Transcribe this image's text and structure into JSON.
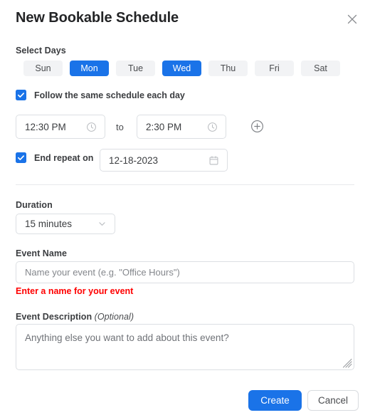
{
  "dialog": {
    "title": "New Bookable Schedule",
    "close_icon": "close-icon"
  },
  "select_days": {
    "label": "Select Days",
    "days": [
      {
        "label": "Sun",
        "selected": false
      },
      {
        "label": "Mon",
        "selected": true
      },
      {
        "label": "Tue",
        "selected": false
      },
      {
        "label": "Wed",
        "selected": true
      },
      {
        "label": "Thu",
        "selected": false
      },
      {
        "label": "Fri",
        "selected": false
      },
      {
        "label": "Sat",
        "selected": false
      }
    ]
  },
  "follow_schedule": {
    "label": "Follow the same schedule each day",
    "checked": true
  },
  "time_range": {
    "start_value": "12:30 PM",
    "separator": "to",
    "end_value": "2:30 PM",
    "start_icon": "clock-icon",
    "end_icon": "clock-icon",
    "add_icon": "plus-circle-icon"
  },
  "end_repeat": {
    "label": "End repeat on",
    "checked": true,
    "date_value": "12-18-2023",
    "date_icon": "calendar-icon"
  },
  "duration": {
    "label": "Duration",
    "value": "15 minutes",
    "chevron_icon": "chevron-down-icon"
  },
  "event_name": {
    "label": "Event Name",
    "value": "",
    "placeholder": "Name your event (e.g. \"Office Hours\")",
    "error": "Enter a name for your event"
  },
  "event_description": {
    "label": "Event Description",
    "label_optional": "(Optional)",
    "value": "",
    "placeholder": "Anything else you want to add about this event?"
  },
  "footer": {
    "create_label": "Create",
    "cancel_label": "Cancel"
  },
  "colors": {
    "accent": "#1a73e8",
    "error": "#ff0000",
    "pill_bg": "#f2f3f5",
    "border": "#dcdfe3"
  }
}
